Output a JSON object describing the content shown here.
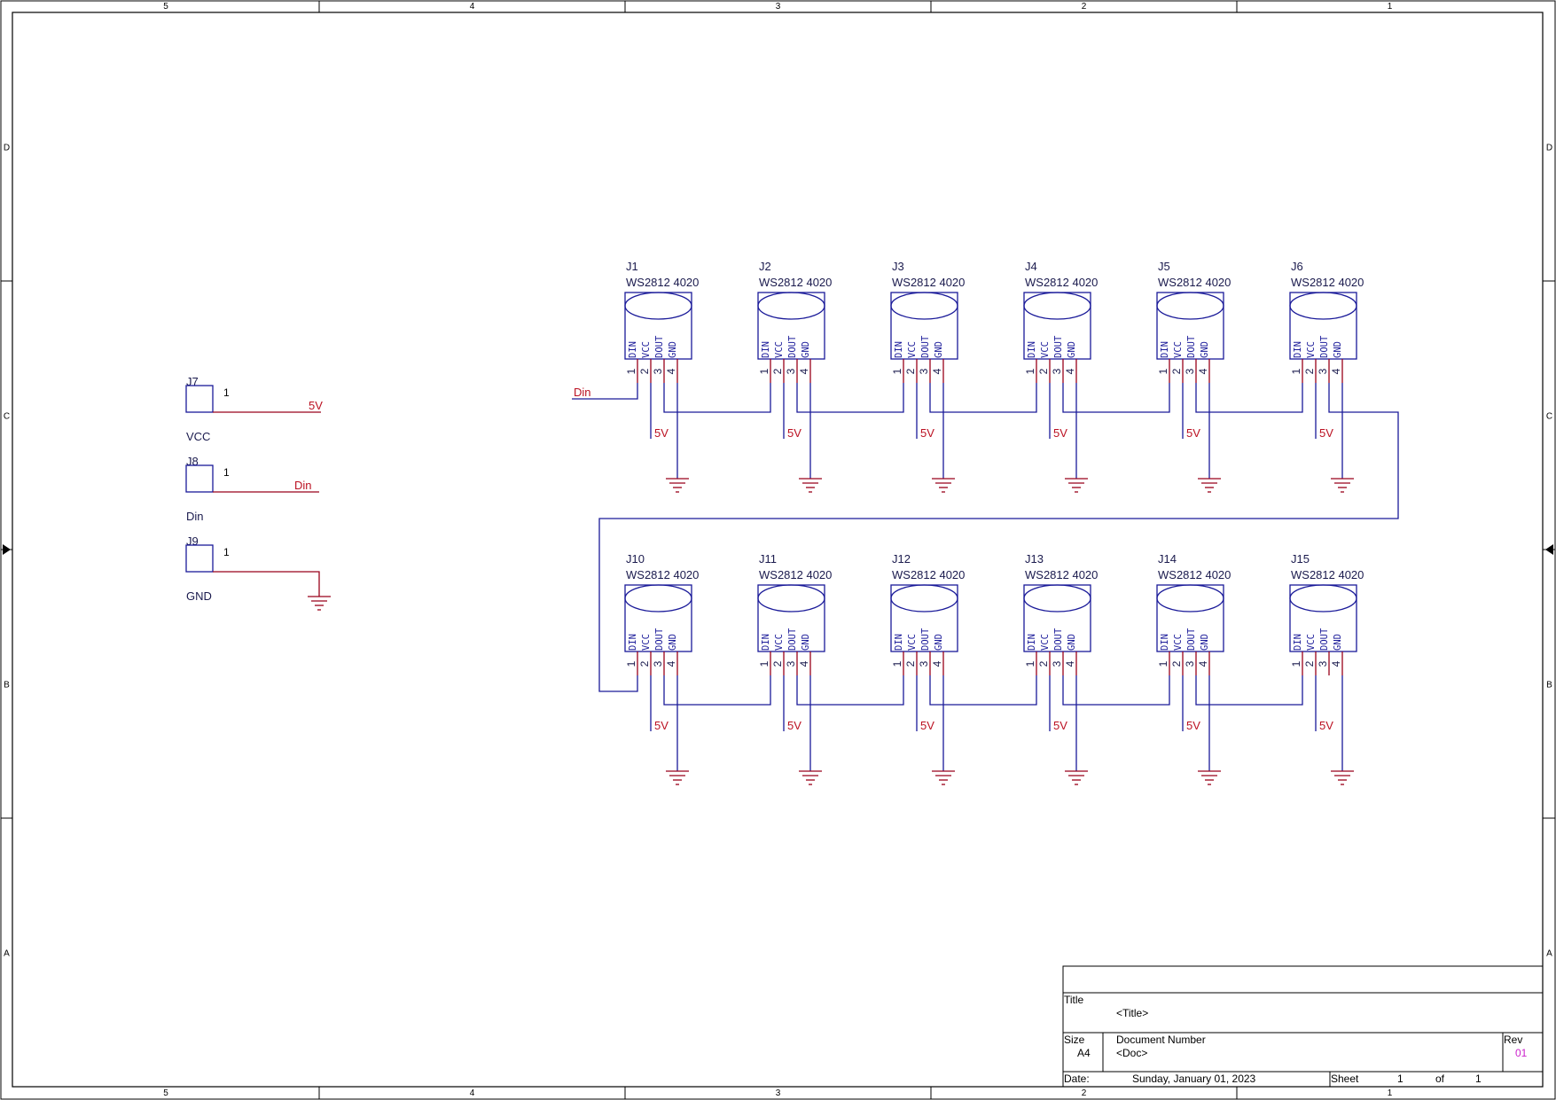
{
  "colors": {
    "border": "#000000",
    "part": "#1a1a99",
    "wire": "#99001a",
    "net_label": "#bb1122",
    "text": "#1a1a4d",
    "rev_value": "#cc22cc"
  },
  "zones": {
    "columns": [
      "5",
      "4",
      "3",
      "2",
      "1"
    ],
    "rows": [
      "D",
      "C",
      "B",
      "A"
    ]
  },
  "pin_names": [
    "DIN",
    "VCC",
    "DOUT",
    "GND"
  ],
  "pin_numbers": [
    "1",
    "2",
    "3",
    "4"
  ],
  "power_label": "5V",
  "led_rows": [
    {
      "parts": [
        {
          "ref": "J1",
          "value": "WS2812 4020"
        },
        {
          "ref": "J2",
          "value": "WS2812 4020"
        },
        {
          "ref": "J3",
          "value": "WS2812 4020"
        },
        {
          "ref": "J4",
          "value": "WS2812 4020"
        },
        {
          "ref": "J5",
          "value": "WS2812 4020"
        },
        {
          "ref": "J6",
          "value": "WS2812 4020"
        }
      ]
    },
    {
      "parts": [
        {
          "ref": "J10",
          "value": "WS2812 4020"
        },
        {
          "ref": "J11",
          "value": "WS2812 4020"
        },
        {
          "ref": "J12",
          "value": "WS2812 4020"
        },
        {
          "ref": "J13",
          "value": "WS2812 4020"
        },
        {
          "ref": "J14",
          "value": "WS2812 4020"
        },
        {
          "ref": "J15",
          "value": "WS2812 4020"
        }
      ]
    }
  ],
  "input_net": "Din",
  "connectors": [
    {
      "ref": "J7",
      "name": "VCC",
      "pin": "1",
      "net": "5V"
    },
    {
      "ref": "J8",
      "name": "Din",
      "pin": "1",
      "net": "Din"
    },
    {
      "ref": "J9",
      "name": "GND",
      "pin": "1",
      "net": ""
    }
  ],
  "title_block": {
    "title_label": "Title",
    "title_value": "<Title>",
    "size_label": "Size",
    "size_value": "A4",
    "docnum_label": "Document Number",
    "docnum_value": "<Doc>",
    "rev_label": "Rev",
    "rev_value": "01",
    "date_label": "Date:",
    "date_value": "Sunday, January 01, 2023",
    "sheet_label": "Sheet",
    "sheet_value": "1",
    "of_label": "of",
    "of_value": "1"
  }
}
